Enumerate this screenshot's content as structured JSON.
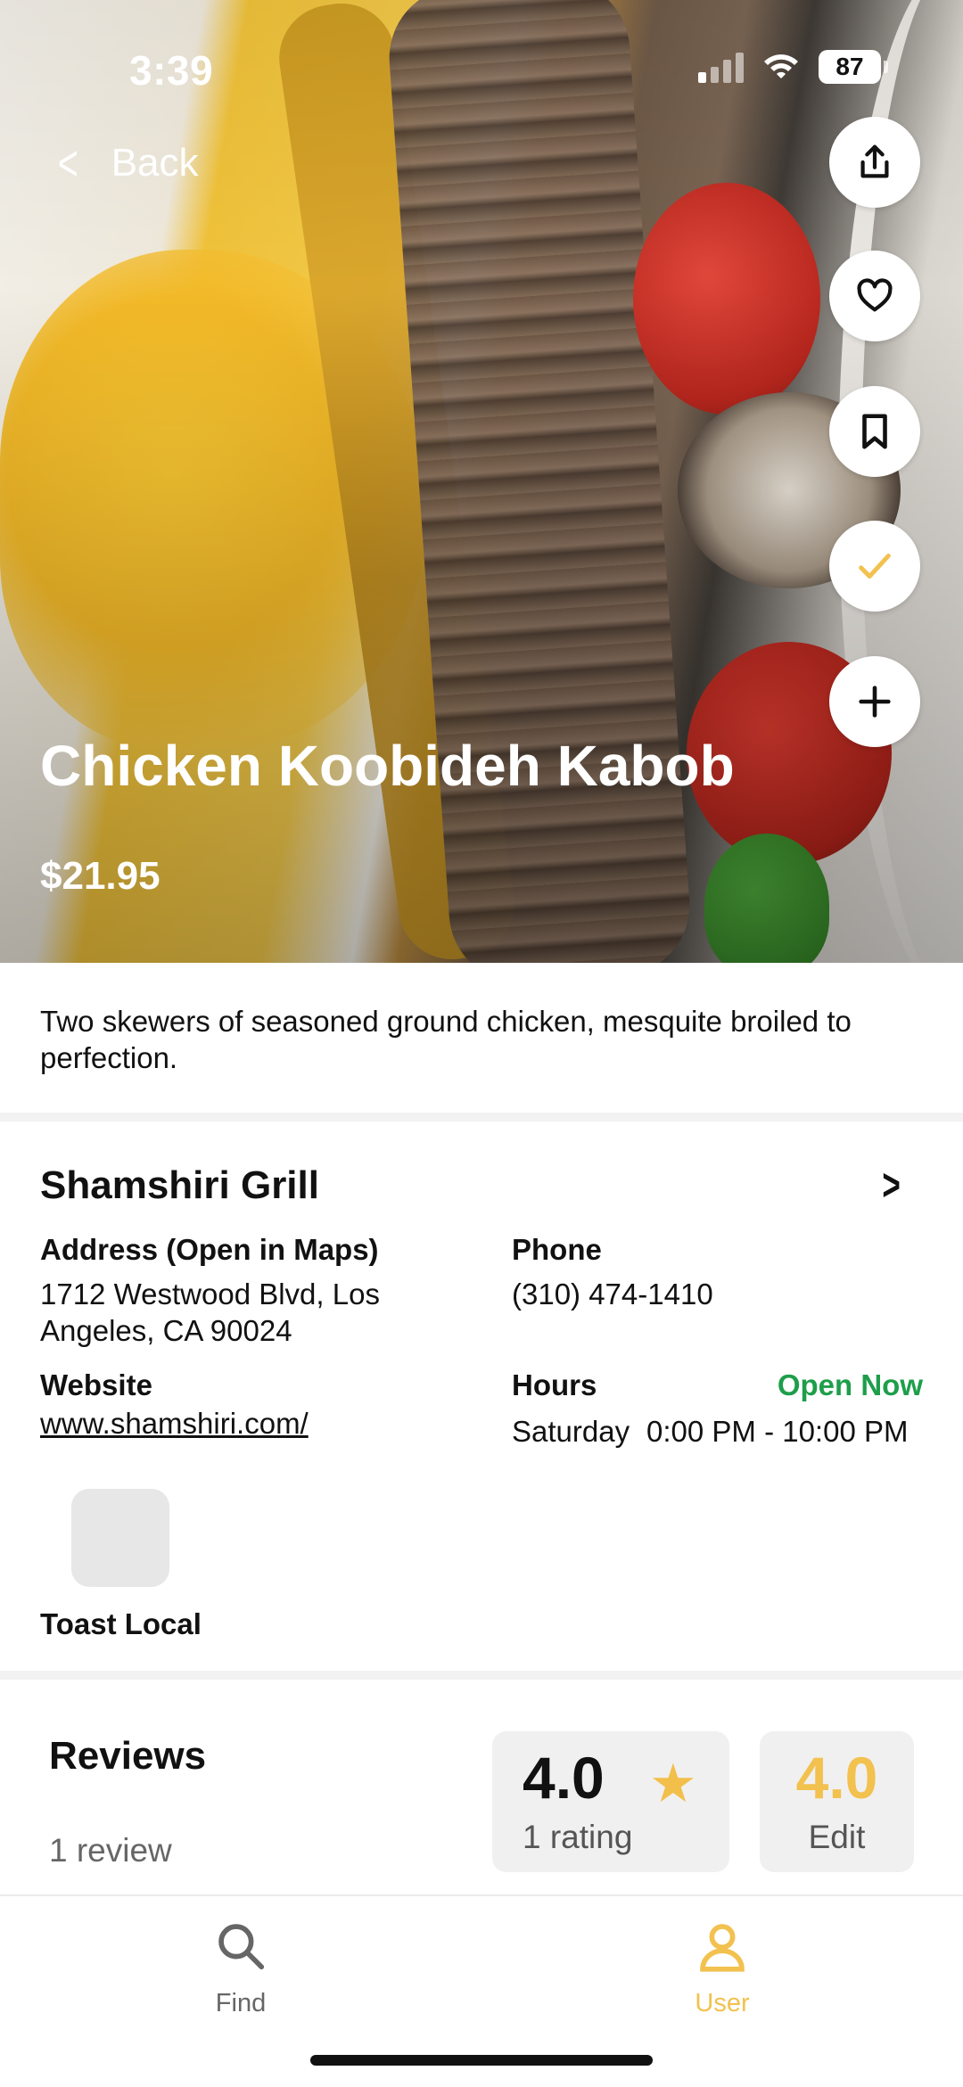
{
  "status_bar": {
    "time": "3:39",
    "battery": "87"
  },
  "nav": {
    "back_label": "Back"
  },
  "hero": {
    "actions": [
      {
        "name": "share-button",
        "icon": "share-icon"
      },
      {
        "name": "like-button",
        "icon": "heart-icon"
      },
      {
        "name": "bookmark-button",
        "icon": "bookmark-icon"
      },
      {
        "name": "tried-button",
        "icon": "check-icon"
      },
      {
        "name": "add-button",
        "icon": "plus-icon"
      }
    ]
  },
  "dish": {
    "title": "Chicken Koobideh Kabob",
    "price": "$21.95",
    "description": "Two skewers of seasoned ground chicken, mesquite broiled to perfection."
  },
  "restaurant": {
    "name": "Shamshiri Grill",
    "address_label": "Address (Open in Maps)",
    "address_line1": "1712 Westwood Blvd, Los",
    "address_line2": "Angeles, CA 90024",
    "phone_label": "Phone",
    "phone": "(310) 474-1410",
    "website_label": "Website",
    "website": "www.shamshiri.com/",
    "hours_label": "Hours",
    "open_status": "Open Now",
    "hours_day": "Saturday",
    "hours_time": "0:00 PM - 10:00 PM",
    "ordering_partner": "Toast Local"
  },
  "reviews": {
    "title": "Reviews",
    "count_label": "1 review",
    "average": "4.0",
    "rating_count_label": "1 rating",
    "my_rating": "4.0",
    "edit_label": "Edit"
  },
  "tabbar": {
    "find_label": "Find",
    "user_label": "User",
    "active": "User"
  },
  "colors": {
    "accent": "#f2c14e",
    "open_green": "#1e9e4a",
    "card_bg": "#f0f0f0"
  }
}
